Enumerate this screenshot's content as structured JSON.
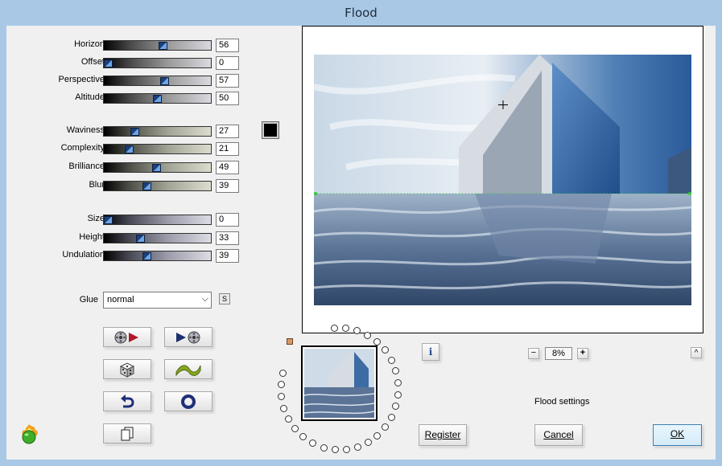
{
  "window": {
    "title": "Flood"
  },
  "sliders": [
    {
      "key": "horizon",
      "label": "Horizon",
      "value": "56",
      "level": 0.56,
      "style": "gray"
    },
    {
      "key": "offset",
      "label": "Offset",
      "value": "0",
      "level": 0.0,
      "style": "gray"
    },
    {
      "key": "perspective",
      "label": "Perspective",
      "value": "57",
      "level": 0.57,
      "style": "gray"
    },
    {
      "key": "altitude",
      "label": "Altitude",
      "value": "50",
      "level": 0.5,
      "style": "gray"
    },
    {
      "key": "waviness",
      "label": "Waviness",
      "value": "27",
      "level": 0.27,
      "style": "olive"
    },
    {
      "key": "complexity",
      "label": "Complexity",
      "value": "21",
      "level": 0.21,
      "style": "olive"
    },
    {
      "key": "brilliance",
      "label": "Brilliance",
      "value": "49",
      "level": 0.49,
      "style": "olive"
    },
    {
      "key": "blur",
      "label": "Blur",
      "value": "39",
      "level": 0.39,
      "style": "olive"
    },
    {
      "key": "size",
      "label": "Size",
      "value": "0",
      "level": 0.0,
      "style": "purple"
    },
    {
      "key": "height",
      "label": "Height",
      "value": "33",
      "level": 0.33,
      "style": "purple"
    },
    {
      "key": "undulation",
      "label": "Undulation",
      "value": "39",
      "level": 0.39,
      "style": "purple"
    }
  ],
  "colors": {
    "flood_color": "#000000",
    "title_bar": "#a9c8e6"
  },
  "glue": {
    "label": "Glue",
    "value": "normal",
    "s_label": "S"
  },
  "zoom": {
    "value": "8%",
    "minus": "−",
    "plus": "+"
  },
  "status": {
    "text": "Flood settings"
  },
  "buttons": {
    "register": "Register",
    "cancel": "Cancel",
    "ok": "OK",
    "info": "i",
    "collapse": "^"
  },
  "icons": {
    "prev_preset": "film-reel-back-icon",
    "next_preset": "film-reel-forward-icon",
    "random": "dice-icon",
    "wave": "wave-icon",
    "undo": "undo-arrow-icon",
    "reset": "ring-icon",
    "copy": "copy-page-icon",
    "logo": "flaming-apple-logo-icon"
  }
}
